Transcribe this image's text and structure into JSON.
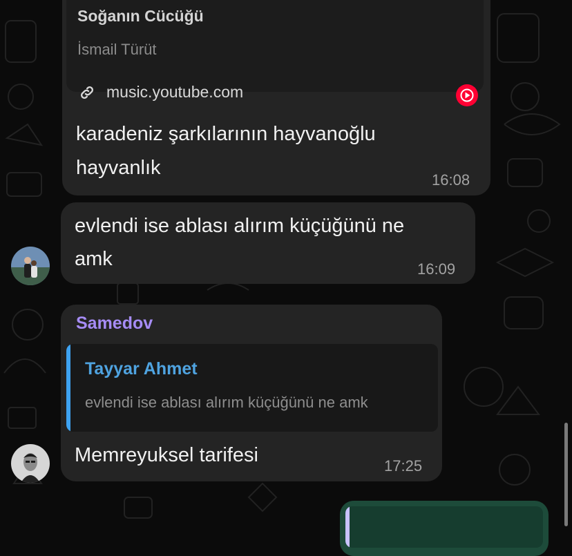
{
  "messages": {
    "link_message": {
      "preview_title": "Soğanın Cücüğü",
      "preview_artist": "İsmail Türüt",
      "preview_url": "music.youtube.com",
      "link_icon": "link-icon",
      "service_icon": "youtube-music-icon",
      "text_line1": "karadeniz şarkılarının hayvanoğlu",
      "text_line2": "hayvanlık",
      "time": "16:08"
    },
    "evlendi_message": {
      "text_line1": "evlendi ise ablası alırım küçüğünü ne",
      "text_line2": "amk",
      "time": "16:09"
    },
    "samedov_message": {
      "sender": "Samedov",
      "reply_name": "Tayyar Ahmet",
      "reply_text": "evlendi ise ablası alırım küçüğünü ne amk",
      "text": "Memreyuksel tarifesi",
      "time": "17:25"
    }
  },
  "colors": {
    "background": "#0b0b0b",
    "bubble_incoming": "#242424",
    "bubble_outgoing": "#1d4b3a",
    "sender_name": "#a68cf5",
    "reply_name": "#4fa3e0",
    "reply_bar": "#3ea3f2",
    "youtube_red": "#ff0033"
  }
}
